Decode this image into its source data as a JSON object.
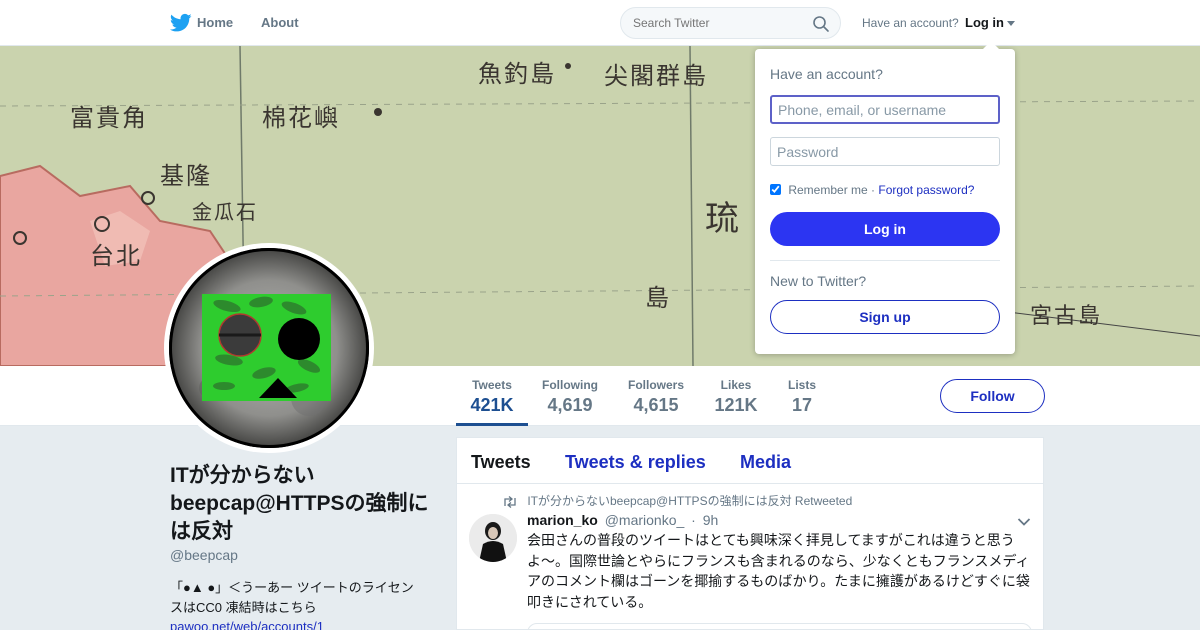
{
  "nav": {
    "logo_icon": "twitter-bird-icon",
    "home_label": "Home",
    "about_label": "About",
    "search_placeholder": "Search Twitter",
    "have_account_text": "Have an account?",
    "login_label": "Log in"
  },
  "banner": {
    "labels": [
      "魚釣島",
      "尖閣群島",
      "富貴角",
      "棉花嶼",
      "基隆",
      "台北",
      "金瓜石",
      "島",
      "宮古島",
      "琉"
    ]
  },
  "profile": {
    "name": "ITが分からない beepcap@HTTPSの強制には反対",
    "handle": "@beepcap",
    "bio": "「●▲ ●」＜うーあー ツイートのライセンスはCC0 凍結時はこちら",
    "link": "pawoo.net/web/accounts/1"
  },
  "stats": [
    {
      "label": "Tweets",
      "value": "421K"
    },
    {
      "label": "Following",
      "value": "4,619"
    },
    {
      "label": "Followers",
      "value": "4,615"
    },
    {
      "label": "Likes",
      "value": "121K"
    },
    {
      "label": "Lists",
      "value": "17"
    }
  ],
  "follow_label": "Follow",
  "timeline": {
    "tabs": [
      "Tweets",
      "Tweets & replies",
      "Media"
    ],
    "tweet": {
      "retweet_text": "ITが分からないbeepcap@HTTPSの強制には反対 Retweeted",
      "name": "marion_ko",
      "handle": "@marionko_",
      "dot": "·",
      "time": "9h",
      "text": "会田さんの普段のツイートはとても興味深く拝見してますがこれは違うと思うよ〜。国際世論とやらにフランスも含まれるのなら、少なくともフランスメディアのコメント欄はゴーンを揶揄するものばかり。たまに擁護があるけどすぐに袋叩きにされている。"
    }
  },
  "login_dropdown": {
    "title": "Have an account?",
    "username_placeholder": "Phone, email, or username",
    "password_placeholder": "Password",
    "remember_label": "Remember me",
    "separator": "·",
    "forgot_label": "Forgot password?",
    "login_button": "Log in",
    "new_text": "New to Twitter?",
    "signup_button": "Sign up"
  },
  "colors": {
    "accent": "#1d2fc1",
    "login_button": "#2c35f2",
    "active_stat": "#1d4f91",
    "avatar_green": "#2ecc2e"
  }
}
